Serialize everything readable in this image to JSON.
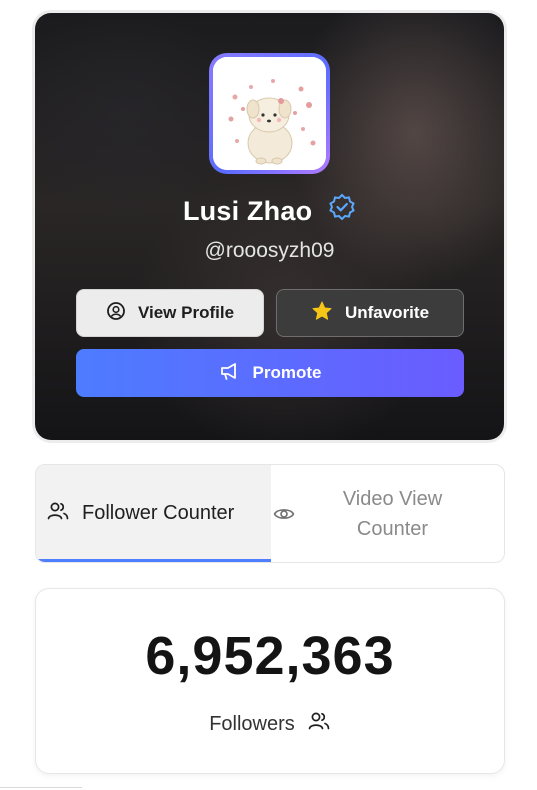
{
  "profile": {
    "name": "Lusi Zhao",
    "handle": "@rooosyzh09",
    "verified": true,
    "buttons": {
      "view_profile": "View Profile",
      "unfavorite": "Unfavorite",
      "promote": "Promote"
    }
  },
  "tabs": [
    {
      "label": "Follower Counter",
      "icon": "users-icon",
      "active": true
    },
    {
      "label_line1": "Video View",
      "label_line2": "Counter",
      "icon": "eye-icon",
      "active": false
    }
  ],
  "counter": {
    "value": "6,952,363",
    "label": "Followers",
    "icon": "users-icon"
  },
  "colors": {
    "accent": "#4f7fff",
    "promote_gradient_start": "#4d7cff",
    "promote_gradient_end": "#6a5cff",
    "verified_badge": "#5aa9ff",
    "star": "#f5c518"
  }
}
